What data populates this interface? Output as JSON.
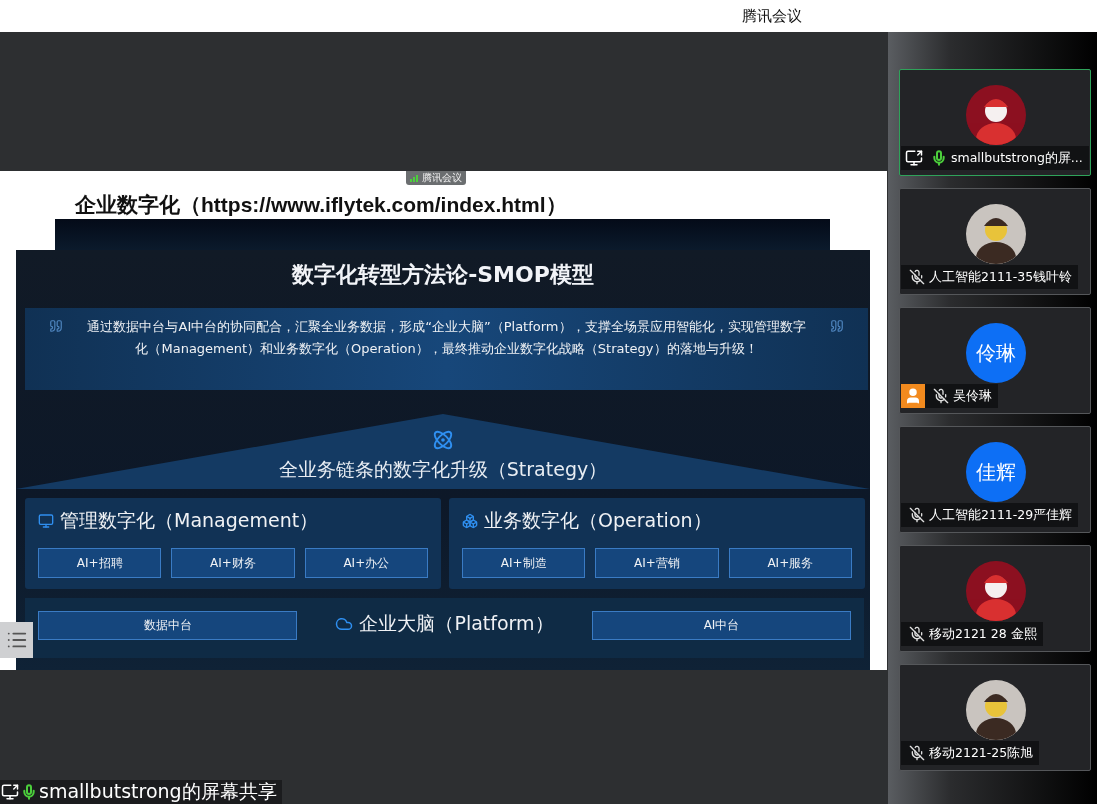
{
  "app_title": "腾讯会议",
  "slide": {
    "overlay_tag": "腾讯会议",
    "title": "企业数字化（https://www.iflytek.com/index.html）",
    "heading": "数字化转型方法论-SMOP模型",
    "quote": "通过数据中台与AI中台的协同配合，汇聚全业务数据，形成“企业大脑”（Platform），支撑全场景应用智能化，实现管理数字化（Management）和业务数字化（Operation），最终推动企业数字化战略（Strategy）的落地与升级！",
    "strategy": "全业务链条的数字化升级（Strategy）",
    "sections": [
      {
        "kind": "management",
        "title": "管理数字化（Management）",
        "items": [
          "AI+招聘",
          "AI+财务",
          "AI+办公"
        ]
      },
      {
        "kind": "operation",
        "title": "业务数字化（Operation）",
        "items": [
          "AI+制造",
          "AI+营销",
          "AI+服务"
        ]
      }
    ],
    "platform": {
      "title": "企业大脑（Platform）",
      "left": "数据中台",
      "right": "AI中台"
    }
  },
  "participants": [
    {
      "name": "smallbutstrong的屏...",
      "muted": false,
      "selected": true,
      "sharing": true,
      "host": false
    },
    {
      "name": "人工智能2111-35钱叶铃",
      "muted": true,
      "selected": false,
      "sharing": false,
      "host": false
    },
    {
      "name": "吴伶琳",
      "avatar": {
        "kind": "initials",
        "text": "伶琳"
      },
      "muted": true,
      "selected": false,
      "sharing": false,
      "host": true
    },
    {
      "name": "人工智能2111-29严佳辉",
      "avatar": {
        "kind": "initials",
        "text": "佳辉"
      },
      "muted": true,
      "selected": false,
      "sharing": false,
      "host": false
    },
    {
      "name": "移动2121 28 金熙",
      "muted": true,
      "selected": false,
      "sharing": false,
      "host": false
    },
    {
      "name": "移动2121-25陈旭",
      "muted": true,
      "selected": false,
      "sharing": false,
      "host": false
    }
  ],
  "share_label": {
    "text": "smallbutstrong的屏幕共享",
    "muted": false
  }
}
